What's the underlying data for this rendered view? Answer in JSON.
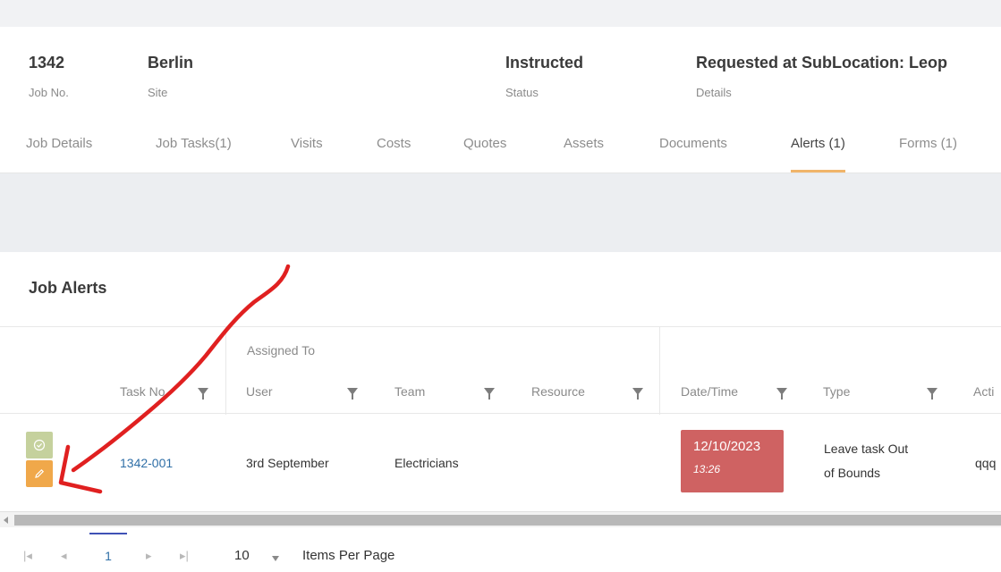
{
  "summary": {
    "job_no": {
      "value": "1342",
      "label": "Job No."
    },
    "site": {
      "value": "Berlin",
      "label": "Site"
    },
    "status": {
      "value": "Instructed",
      "label": "Status"
    },
    "details": {
      "value": "Requested at SubLocation: Leop",
      "label": "Details"
    }
  },
  "tabs": [
    {
      "label": "Job Details"
    },
    {
      "label": "Job Tasks(1)"
    },
    {
      "label": "Visits"
    },
    {
      "label": "Costs"
    },
    {
      "label": "Quotes"
    },
    {
      "label": "Assets"
    },
    {
      "label": "Documents"
    },
    {
      "label": "Alerts (1)",
      "active": true
    },
    {
      "label": "Forms (1)"
    }
  ],
  "section_title": "Job Alerts",
  "grid": {
    "group_header": "Assigned To",
    "columns": [
      "Task No.",
      "User",
      "Team",
      "Resource",
      "Date/Time",
      "Type",
      "Acti"
    ],
    "rows": [
      {
        "task_no": "1342-001",
        "user": "3rd September",
        "team": "Electricians",
        "resource": "",
        "date": "12/10/2023",
        "time": "13:26",
        "type_line1": "Leave task Out",
        "type_line2": "of Bounds",
        "action": "qqq"
      }
    ]
  },
  "pager": {
    "first": "|◂",
    "prev": "◂",
    "page": "1",
    "next": "▸",
    "last": "▸|",
    "page_size": "10",
    "items_per_page_label": "Items Per Page"
  },
  "colors": {
    "accent_tab": "#f0b46a",
    "date_badge": "#cf6262",
    "approve_button": "#c5d19d",
    "edit_button": "#f0a84a",
    "link": "#2f6fa7",
    "annotation": "#e02020"
  },
  "icons": {
    "approve": "check-circle-icon",
    "edit": "pencil-icon",
    "filter": "funnel-icon"
  }
}
